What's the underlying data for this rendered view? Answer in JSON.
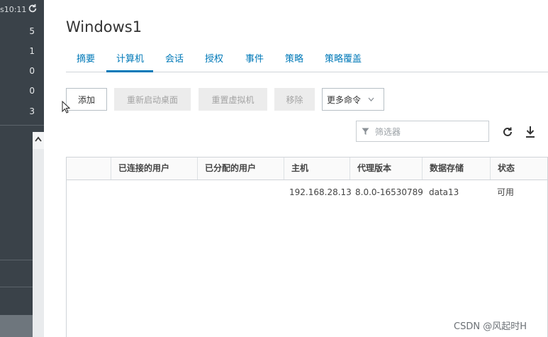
{
  "sidebar": {
    "time": "s10:11",
    "counts": [
      "5",
      "1",
      "0",
      "0",
      "3"
    ]
  },
  "page": {
    "title": "Windows1"
  },
  "tabs": [
    {
      "label": "摘要"
    },
    {
      "label": "计算机"
    },
    {
      "label": "会话"
    },
    {
      "label": "授权"
    },
    {
      "label": "事件"
    },
    {
      "label": "策略"
    },
    {
      "label": "策略覆盖"
    }
  ],
  "active_tab": "计算机",
  "toolbar": {
    "add_label": "添加",
    "restart_label": "重新启动桌面",
    "reset_label": "重置虚拟机",
    "remove_label": "移除",
    "more_label": "更多命令"
  },
  "filter": {
    "placeholder": "筛选器"
  },
  "grid": {
    "columns": [
      "",
      "已连接的用户",
      "已分配的用户",
      "主机",
      "代理版本",
      "数据存储",
      "状态"
    ],
    "rows": [
      [
        "",
        "",
        "",
        "192.168.28.13",
        "8.0.0-16530789",
        "data13",
        "可用"
      ]
    ]
  },
  "watermark": "CSDN @风起时H",
  "colors": {
    "accent": "#0079b8",
    "sidebar_bg": "#3a4249"
  }
}
